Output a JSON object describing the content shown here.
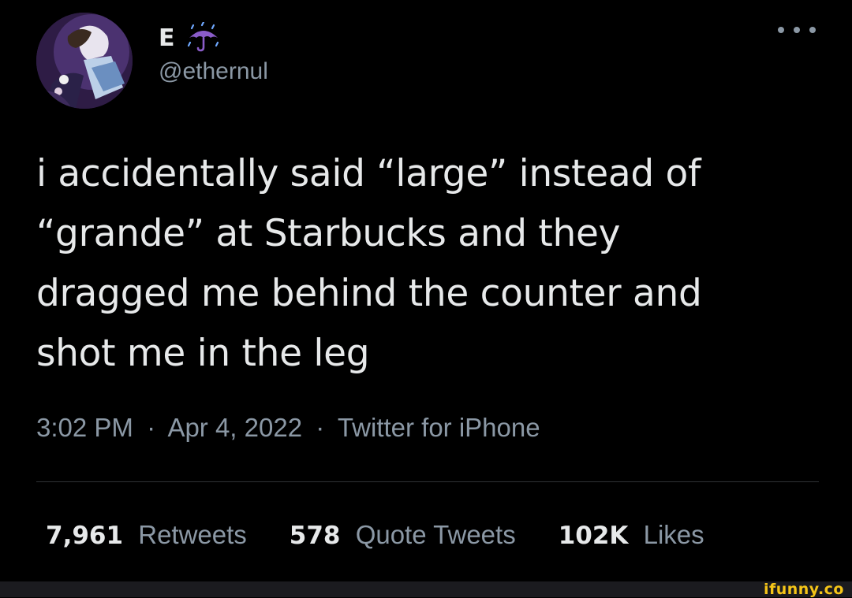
{
  "tweet": {
    "author": {
      "display_name": "E",
      "name_emoji": "umbrella-with-rain-icon",
      "handle": "@ethernul"
    },
    "more_icon": "more-options-icon",
    "text": "i accidentally said “large” instead of\n“grande” at Starbucks and they\ndragged me behind the counter and\nshot me in the leg",
    "time": "3:02 PM",
    "separator": "·",
    "date": "Apr 4, 2022",
    "source": "Twitter for iPhone",
    "stats": {
      "retweets": {
        "count": "7,961",
        "label": "Retweets"
      },
      "quote_tweets": {
        "count": "578",
        "label": "Quote Tweets"
      },
      "likes": {
        "count": "102K",
        "label": "Likes"
      }
    }
  },
  "watermark": "ifunny.co",
  "colors": {
    "background": "#000000",
    "primary_text": "#e7e9ea",
    "secondary_text": "#8b98a5",
    "divider": "#2f3336",
    "umbrella": "#8a5cc8",
    "watermark": "#f5c518"
  }
}
